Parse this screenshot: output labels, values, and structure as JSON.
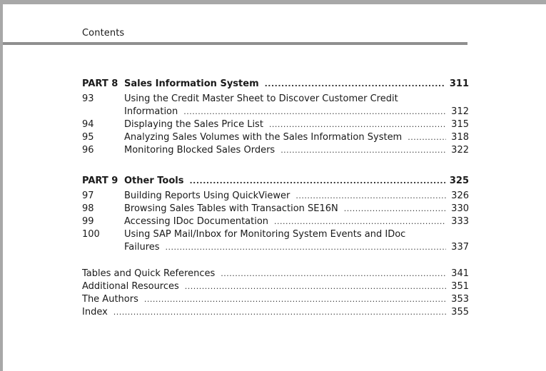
{
  "running_head": "Contents",
  "part8": {
    "label": "PART 8",
    "title": "Sales Information System",
    "page": "311",
    "chapters": [
      {
        "num": "93",
        "title_line1": "Using the Credit Master Sheet to Discover Customer Credit",
        "title_line2": "Information",
        "page": "312"
      },
      {
        "num": "94",
        "title": "Displaying the Sales Price List",
        "page": "315"
      },
      {
        "num": "95",
        "title": "Analyzing Sales Volumes with the Sales Information System",
        "page": "318"
      },
      {
        "num": "96",
        "title": "Monitoring Blocked Sales Orders",
        "page": "322"
      }
    ]
  },
  "part9": {
    "label": "PART 9",
    "title": "Other Tools",
    "page": "325",
    "chapters": [
      {
        "num": "97",
        "title": "Building Reports Using QuickViewer",
        "page": "326"
      },
      {
        "num": "98",
        "title": "Browsing Sales Tables with Transaction SE16N",
        "page": "330"
      },
      {
        "num": "99",
        "title": "Accessing IDoc Documentation",
        "page": "333"
      },
      {
        "num": "100",
        "title_line1": "Using SAP Mail/Inbox for Monitoring System Events and IDoc",
        "title_line2": "Failures",
        "page": "337"
      }
    ]
  },
  "back_matter": [
    {
      "title": "Tables and Quick References",
      "page": "341"
    },
    {
      "title": "Additional Resources",
      "page": "351"
    },
    {
      "title": "The Authors",
      "page": "353"
    },
    {
      "title": "Index",
      "page": "355"
    }
  ]
}
